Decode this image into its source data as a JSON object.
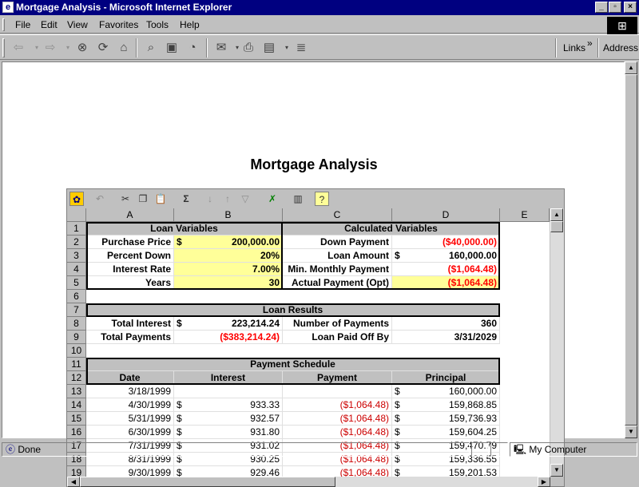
{
  "window": {
    "title": "Mortgage Analysis - Microsoft Internet Explorer",
    "min": "_",
    "max": "▫",
    "close": "×"
  },
  "menu": [
    "File",
    "Edit",
    "View",
    "Favorites",
    "Tools",
    "Help"
  ],
  "toolbar": {
    "links_label": "Links",
    "chevron": "»",
    "address_label": "Address"
  },
  "page": {
    "heading": "Mortgage Analysis"
  },
  "spreadsheet": {
    "columns": [
      "A",
      "B",
      "C",
      "D",
      "E"
    ],
    "rows": [
      "1",
      "2",
      "3",
      "4",
      "5",
      "6",
      "7",
      "8",
      "9",
      "10",
      "11",
      "12",
      "13",
      "14",
      "15",
      "16",
      "17",
      "18",
      "19"
    ],
    "loan_variables_title": "Loan Variables",
    "calculated_variables_title": "Calculated Variables",
    "loan_results_title": "Loan Results",
    "payment_schedule_title": "Payment Schedule",
    "dollar": "$",
    "r2": {
      "a": "Purchase Price",
      "b": "200,000.00",
      "c": "Down Payment",
      "d": "($40,000.00)"
    },
    "r3": {
      "a": "Percent Down",
      "b": "20%",
      "c": "Loan Amount",
      "d": "160,000.00"
    },
    "r4": {
      "a": "Interest Rate",
      "b": "7.00%",
      "c": "Min. Monthly Payment",
      "d": "($1,064.48)"
    },
    "r5": {
      "a": "Years",
      "b": "30",
      "c": "Actual Payment (Opt)",
      "d": "($1,064.48)"
    },
    "r8": {
      "a": "Total Interest",
      "b": "223,214.24",
      "c": "Number of Payments",
      "d": "360"
    },
    "r9": {
      "a": "Total Payments",
      "b": "($383,214.24)",
      "c": "Loan Paid Off By",
      "d": "3/31/2029"
    },
    "schedule_headers": {
      "date": "Date",
      "interest": "Interest",
      "payment": "Payment",
      "principal": "Principal"
    },
    "schedule": [
      {
        "date": "3/18/1999",
        "interest": "",
        "payment": "",
        "principal": "160,000.00"
      },
      {
        "date": "4/30/1999",
        "interest": "933.33",
        "payment": "($1,064.48)",
        "principal": "159,868.85"
      },
      {
        "date": "5/31/1999",
        "interest": "932.57",
        "payment": "($1,064.48)",
        "principal": "159,736.93"
      },
      {
        "date": "6/30/1999",
        "interest": "931.80",
        "payment": "($1,064.48)",
        "principal": "159,604.25"
      },
      {
        "date": "7/31/1999",
        "interest": "931.02",
        "payment": "($1,064.48)",
        "principal": "159,470.79"
      },
      {
        "date": "8/31/1999",
        "interest": "930.25",
        "payment": "($1,064.48)",
        "principal": "159,336.55"
      },
      {
        "date": "9/30/1999",
        "interest": "929.46",
        "payment": "($1,064.48)",
        "principal": "159,201.53"
      }
    ]
  },
  "statusbar": {
    "status": "Done",
    "zone": "My Computer"
  },
  "colors": {
    "titlebar": "#000080",
    "highlight": "#ffff99",
    "negative": "#ff0000"
  }
}
